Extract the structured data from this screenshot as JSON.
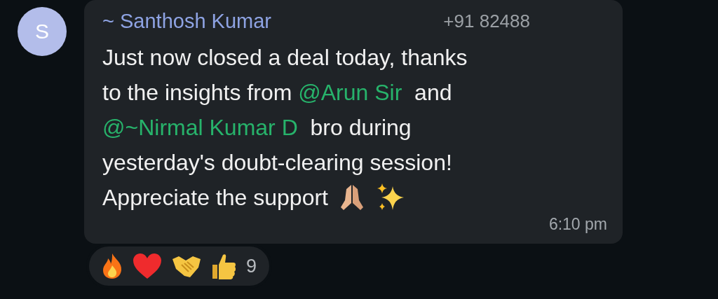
{
  "avatar": {
    "letter": "S"
  },
  "message": {
    "sender": "~ Santhosh Kumar",
    "phone": "+91 82488",
    "lines": [
      [
        {
          "kind": "text",
          "text": "Just now closed a deal today, thanks"
        }
      ],
      [
        {
          "kind": "text",
          "text": "to the insights from "
        },
        {
          "kind": "mention",
          "text": "@Arun Sir"
        },
        {
          "kind": "text",
          "text": "  and"
        }
      ],
      [
        {
          "kind": "mention",
          "text": "@~Nirmal Kumar D"
        },
        {
          "kind": "text",
          "text": "  bro during"
        }
      ],
      [
        {
          "kind": "text",
          "text": "yesterday's doubt-clearing session!"
        }
      ],
      [
        {
          "kind": "text",
          "text": "Appreciate the support"
        }
      ]
    ],
    "time": "6:10 pm"
  },
  "reactions": {
    "count": "9"
  }
}
